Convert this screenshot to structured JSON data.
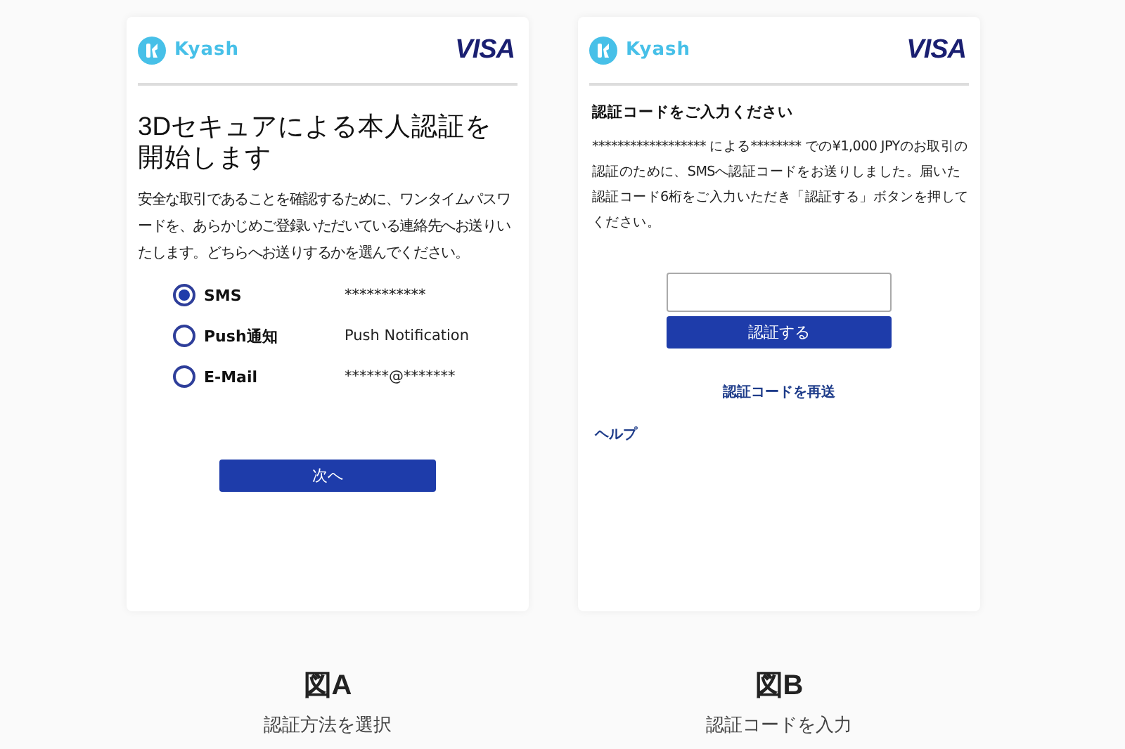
{
  "figures": [
    {
      "screen": {
        "kind": "method-select",
        "brand": "Kyash",
        "card_brand": "VISA",
        "title": "3Dセキュアによる本人認証を開始します",
        "description": "安全な取引であることを確認するために、ワンタイムパスワードを、あらかじめご登録いただいている連絡先へお送りいたします。どちらへお送りするかを選んでください。",
        "options": [
          {
            "label": "SMS",
            "destination": "***********",
            "selected": true
          },
          {
            "label": "Push通知",
            "destination": "Push Notification",
            "selected": false
          },
          {
            "label": "E-Mail",
            "destination": "******@*******",
            "selected": false
          }
        ],
        "button": "次へ"
      },
      "caption": {
        "label": "図A",
        "text": "認証方法を選択"
      }
    },
    {
      "screen": {
        "kind": "code-entry",
        "brand": "Kyash",
        "card_brand": "VISA",
        "title": "認証コードをご入力ください",
        "message": "****************** による******** での¥1,000 JPYのお取引の認証のために、SMSへ認証コードをお送りしました。届いた認証コード6桁をご入力いただき「認証する」ボタンを押してください。",
        "button": "認証する",
        "resend_link": "認証コードを再送",
        "help_link": "ヘルプ"
      },
      "caption": {
        "label": "図B",
        "text": "認証コードを入力"
      }
    }
  ]
}
